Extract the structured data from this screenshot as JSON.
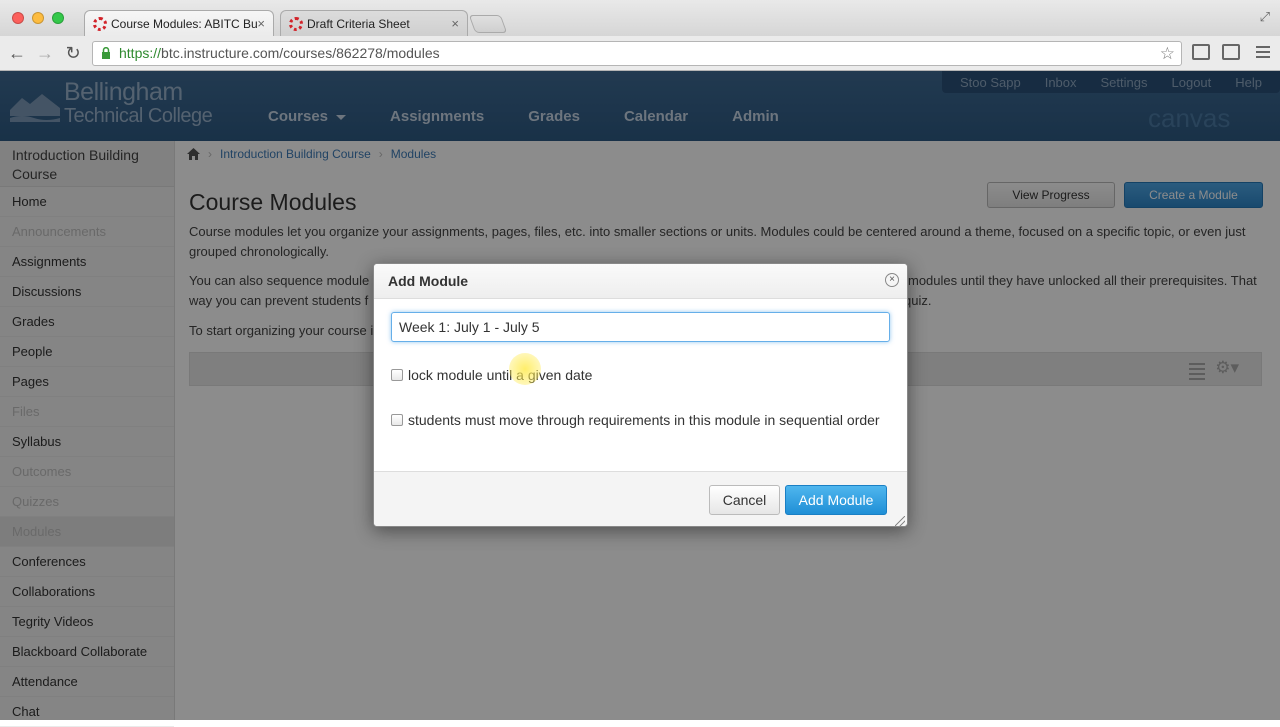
{
  "browser": {
    "tabs": [
      {
        "title": "Course Modules: ABITC Bu"
      },
      {
        "title": "Draft Criteria Sheet"
      }
    ],
    "url_protocol": "https://",
    "url_rest": "btc.instructure.com/courses/862278/modules"
  },
  "header": {
    "logo_line1": "Bellingham",
    "logo_line2": "Technical College",
    "nav": [
      "Courses",
      "Assignments",
      "Grades",
      "Calendar",
      "Admin"
    ],
    "user_links": [
      "Stoo Sapp",
      "Inbox",
      "Settings",
      "Logout",
      "Help"
    ],
    "brand": "canvas"
  },
  "sidebar": {
    "course_title": "Introduction Building Course",
    "items": [
      {
        "label": "Home",
        "state": "normal"
      },
      {
        "label": "Announcements",
        "state": "disabled"
      },
      {
        "label": "Assignments",
        "state": "normal"
      },
      {
        "label": "Discussions",
        "state": "normal"
      },
      {
        "label": "Grades",
        "state": "normal"
      },
      {
        "label": "People",
        "state": "normal"
      },
      {
        "label": "Pages",
        "state": "normal"
      },
      {
        "label": "Files",
        "state": "disabled"
      },
      {
        "label": "Syllabus",
        "state": "normal"
      },
      {
        "label": "Outcomes",
        "state": "disabled"
      },
      {
        "label": "Quizzes",
        "state": "disabled"
      },
      {
        "label": "Modules",
        "state": "active"
      },
      {
        "label": "Conferences",
        "state": "normal"
      },
      {
        "label": "Collaborations",
        "state": "normal"
      },
      {
        "label": "Tegrity Videos",
        "state": "normal"
      },
      {
        "label": "Blackboard Collaborate",
        "state": "normal"
      },
      {
        "label": "Attendance",
        "state": "normal"
      },
      {
        "label": "Chat",
        "state": "normal"
      }
    ]
  },
  "breadcrumb": {
    "course": "Introduction Building Course",
    "current": "Modules"
  },
  "main": {
    "title": "Course Modules",
    "view_progress_label": "View Progress",
    "create_module_label": "Create a Module",
    "para1": "Course modules let you organize your assignments, pages, files, etc. into smaller sections or units. Modules could be centered around a theme, focused on a specific topic, or even just grouped chronologically.",
    "para2_left": "You can also sequence module",
    "para2_right": "modules until they have unlocked all their prerequisites. That",
    "para2b_left": "way you can prevent students f",
    "para2b_right": "quiz.",
    "para3_left": "To start organizing your course i"
  },
  "dialog": {
    "title": "Add Module",
    "name_value": "Week 1: July 1 - July 5",
    "lock_label": "lock module until a given date",
    "sequential_label": "students must move through requirements in this module in sequential order",
    "cancel_label": "Cancel",
    "add_label": "Add Module"
  }
}
